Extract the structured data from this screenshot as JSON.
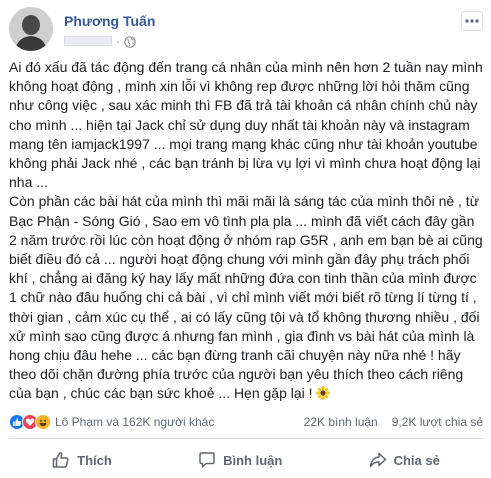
{
  "post": {
    "author": "Phương Tuấn",
    "paragraphs": [
      "Ai đó xấu đã tác động đến trang cá nhân của mình nên hơn 2 tuần nay mình không hoạt động , mình xin lỗi vì không rep được những lời hỏi thăm cũng như công việc , sau xác minh thì FB đã trả tài khoản cá nhân chính chủ này cho mình ... hiện tại Jack chỉ sử dụng duy nhất tài khoản này và instagram mang tên iamjack1997 ... mọi trang mạng khác cũng như tài khoản youtube không phải Jack nhé , các bạn tránh bị lừa vụ lợi vì mình chưa hoạt động lại nha ...",
      "Còn phần các bài hát của mình thì mãi mãi là sáng tác của mình thôi nè , từ Bạc Phận - Sóng Gió , Sao em vô tình pla pla ... mình đã viết cách đây gần 2 năm trước rồi lúc còn hoạt động ở nhóm rap G5R , anh em bạn bè ai cũng biết điều đó cả ... người hoạt động chung với mình gần đây phụ trách phối khí , chẳng ai đăng ký hay lấy mất những đứa con tinh thần của mình được 1 chữ nào đâu huống chi cả bài , vì chỉ mình viết mới biết rõ từng lí từng tí , thời gian , cảm xúc cụ thể , ai có lấy cũng tội và tổ không thương nhiều , đối xử mình sao cũng được á nhưng fan mình , gia đình vs bài hát của mình là hong chịu đâu hehe ... các bạn đừng tranh cãi chuyện này nữa nhé ! hãy theo dõi chặn đường phía trước của người bạn yêu thích theo cách riêng của bạn , chúc các bạn sức khoẻ ... Hẹn gặp lại !"
    ],
    "emoji_icon": "sunflower-icon"
  },
  "reactions": {
    "summary": "Lô Phạm và 162K người khác",
    "icons": [
      "like-icon",
      "love-icon",
      "haha-icon"
    ],
    "comments": "22K bình luận",
    "shares": "9,2K lượt chia sẻ"
  },
  "actions": {
    "like": "Thích",
    "comment": "Bình luận",
    "share": "Chia sẻ"
  },
  "colors": {
    "author": "#385898",
    "text": "#1c1e21",
    "muted": "#606770",
    "like": "#1877f2",
    "love": "#f33e58",
    "haha": "#f7b125"
  }
}
